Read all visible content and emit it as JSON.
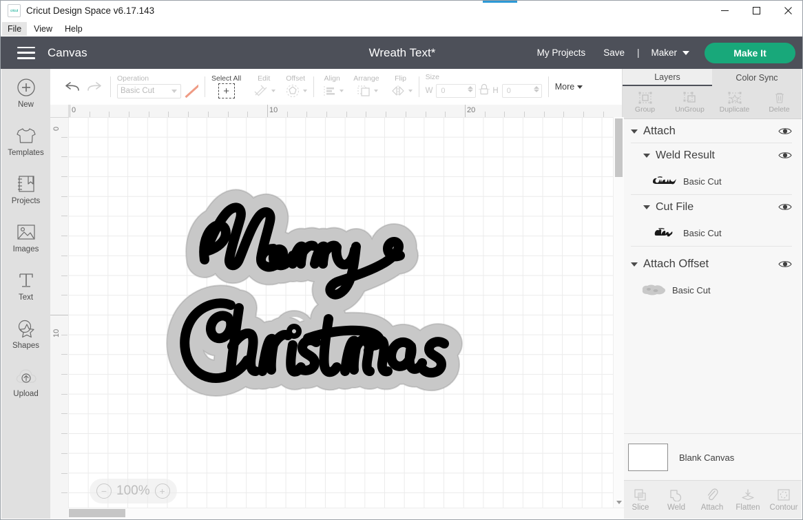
{
  "window": {
    "app_title": "Cricut Design Space  v6.17.143",
    "logo_text": "cricut",
    "minimize_icon": "minimize-icon",
    "maximize_icon": "maximize-icon",
    "close_icon": "close-icon"
  },
  "menubar": {
    "items": [
      {
        "label": "File",
        "active": true
      },
      {
        "label": "View",
        "active": false
      },
      {
        "label": "Help",
        "active": false
      }
    ]
  },
  "header": {
    "menu_icon": "hamburger-menu-icon",
    "canvas_label": "Canvas",
    "doc_title": "Wreath Text*",
    "my_projects": "My Projects",
    "save": "Save",
    "divider": "|",
    "machine": "Maker",
    "make_it": "Make It",
    "accent_green": "#18a87a",
    "header_bg": "#4d5059"
  },
  "rail": {
    "items": [
      {
        "label": "New",
        "icon": "plus-circle-icon"
      },
      {
        "label": "Templates",
        "icon": "tshirt-icon"
      },
      {
        "label": "Projects",
        "icon": "notebook-icon"
      },
      {
        "label": "Images",
        "icon": "picture-icon"
      },
      {
        "label": "Text",
        "icon": "text-icon"
      },
      {
        "label": "Shapes",
        "icon": "shapes-icon"
      },
      {
        "label": "Upload",
        "icon": "cloud-upload-icon"
      }
    ]
  },
  "toolbar": {
    "undo_icon": "undo-arrow-icon",
    "redo_icon": "redo-arrow-icon",
    "operation_caption": "Operation",
    "operation_value": "Basic Cut",
    "operation_color": "#ef9b84",
    "select_all_caption": "Select All",
    "edit_caption": "Edit",
    "offset_caption": "Offset",
    "align_caption": "Align",
    "arrange_caption": "Arrange",
    "flip_caption": "Flip",
    "size_caption": "Size",
    "width_letter": "W",
    "width_value": "0",
    "height_letter": "H",
    "height_value": "0",
    "lock_icon": "lock-icon",
    "more_label": "More"
  },
  "canvas": {
    "ruler_h_labels": [
      "0",
      "10",
      "20"
    ],
    "ruler_v_labels": [
      "0",
      "10"
    ],
    "zoom_level": "100%",
    "zoom_out_icon": "minus-circle-icon",
    "zoom_in_icon": "plus-circle-icon",
    "artwork_text_line1": "Merry",
    "artwork_text_line2": "Christmas",
    "artwork_fill": "#000000",
    "artwork_offset_fill": "#c8c8c8"
  },
  "layers_panel": {
    "tabs": [
      {
        "label": "Layers",
        "active": true
      },
      {
        "label": "Color Sync",
        "active": false
      }
    ],
    "actions": [
      {
        "label": "Group",
        "icon": "group-icon"
      },
      {
        "label": "UnGroup",
        "icon": "ungroup-icon"
      },
      {
        "label": "Duplicate",
        "icon": "duplicate-icon"
      },
      {
        "label": "Delete",
        "icon": "trash-icon"
      }
    ],
    "rows": [
      {
        "type": "group",
        "indent": 0,
        "label": "Attach",
        "eye": true
      },
      {
        "type": "group",
        "indent": 1,
        "label": "Weld Result",
        "eye": true
      },
      {
        "type": "layer",
        "indent": 2,
        "label": "Basic Cut",
        "thumb": "christmas-script-thumb"
      },
      {
        "type": "group",
        "indent": 1,
        "label": "Cut File",
        "eye": true
      },
      {
        "type": "layer",
        "indent": 2,
        "label": "Basic Cut",
        "thumb": "merry-script-thumb"
      },
      {
        "type": "group",
        "indent": 0,
        "label": "Attach Offset",
        "eye": true
      },
      {
        "type": "layer",
        "indent": 1,
        "label": "Basic Cut",
        "thumb": "offset-blob-thumb"
      }
    ],
    "canvas_row": {
      "label": "Blank Canvas",
      "swatch_color": "#ffffff"
    },
    "bottom_tools": [
      {
        "label": "Slice",
        "icon": "slice-icon"
      },
      {
        "label": "Weld",
        "icon": "weld-icon"
      },
      {
        "label": "Attach",
        "icon": "paperclip-icon"
      },
      {
        "label": "Flatten",
        "icon": "flatten-icon"
      },
      {
        "label": "Contour",
        "icon": "contour-icon"
      }
    ]
  }
}
